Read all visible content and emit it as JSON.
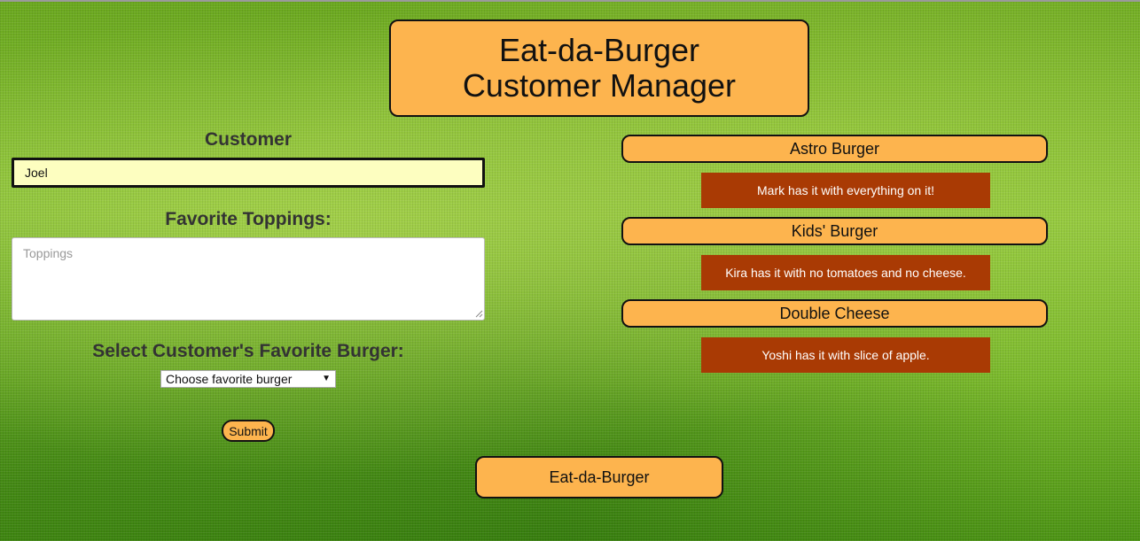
{
  "header": {
    "title_line1": "Eat-da-Burger",
    "title_line2": "Customer Manager"
  },
  "form": {
    "customer_label": "Customer",
    "customer_value": "Joel",
    "toppings_label": "Favorite Toppings:",
    "toppings_placeholder": "Toppings",
    "burger_label": "Select Customer's Favorite Burger:",
    "burger_select_value": "Choose favorite burger",
    "submit_label": "Submit"
  },
  "burgers": [
    {
      "name": "Astro Burger",
      "note": "Mark has it with everything on it!"
    },
    {
      "name": "Kids' Burger",
      "note": "Kira has it with no tomatoes and no cheese."
    },
    {
      "name": "Double Cheese",
      "note": "Yoshi has it with slice of apple."
    }
  ],
  "footer": {
    "label": "Eat-da-Burger"
  },
  "colors": {
    "accent_orange": "#fdb44e",
    "note_background": "#a93a04",
    "input_highlight": "#fdfec0",
    "background_green": "#7cb82a"
  },
  "icons": {
    "select_arrow": "chevron-down-icon",
    "resize_grip": "resize-grip-icon"
  }
}
